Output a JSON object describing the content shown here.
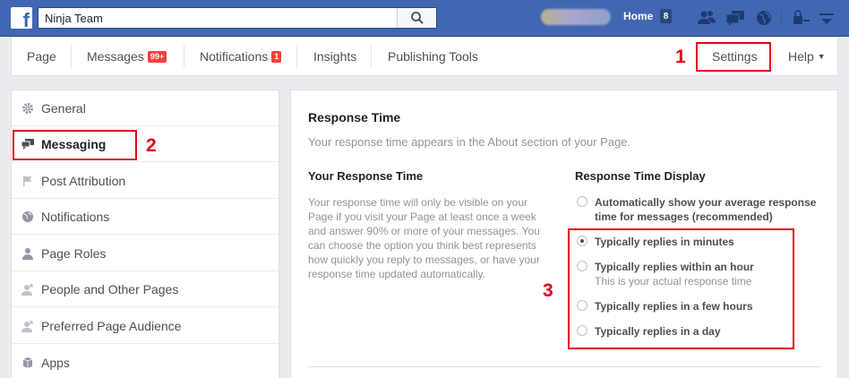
{
  "topbar": {
    "search_value": "Ninja Team",
    "home_label": "Home",
    "home_count": "8"
  },
  "pagenav": {
    "page": "Page",
    "messages": "Messages",
    "messages_badge": "99+",
    "notifications": "Notifications",
    "notifications_badge": "1",
    "insights": "Insights",
    "publishing_tools": "Publishing Tools",
    "settings": "Settings",
    "help": "Help"
  },
  "annotations": {
    "one": "1",
    "two": "2",
    "three": "3"
  },
  "sidebar": {
    "items": [
      {
        "label": "General",
        "icon": "gear-icon"
      },
      {
        "label": "Messaging",
        "icon": "messaging-icon"
      },
      {
        "label": "Post Attribution",
        "icon": "flag-icon"
      },
      {
        "label": "Notifications",
        "icon": "globe-icon"
      },
      {
        "label": "Page Roles",
        "icon": "person-icon"
      },
      {
        "label": "People and Other Pages",
        "icon": "person-star-icon"
      },
      {
        "label": "Preferred Page Audience",
        "icon": "person-star-icon"
      },
      {
        "label": "Apps",
        "icon": "apps-icon"
      }
    ]
  },
  "main": {
    "title": "Response Time",
    "subtitle": "Your response time appears in the About section of your Page.",
    "your_response_title": "Your Response Time",
    "description": "Your response time will only be visible on your Page if you visit your Page at least once a week and answer 90% or more of your messages. You can choose the option you think best represents how quickly you reply to messages, or have your response time updated automatically.",
    "display_title": "Response Time Display",
    "options": [
      {
        "label": "Automatically show your average response time for messages (recommended)",
        "sub": ""
      },
      {
        "label": "Typically replies in minutes",
        "sub": ""
      },
      {
        "label": "Typically replies within an hour",
        "sub": "This is your actual response time"
      },
      {
        "label": "Typically replies in a few hours",
        "sub": ""
      },
      {
        "label": "Typically replies in a day",
        "sub": ""
      }
    ],
    "selected_option": "Typically replies in minutes"
  },
  "colors": {
    "brand": "#4267b2",
    "annotation": "#e2001a",
    "badge": "#fa3e3e"
  }
}
